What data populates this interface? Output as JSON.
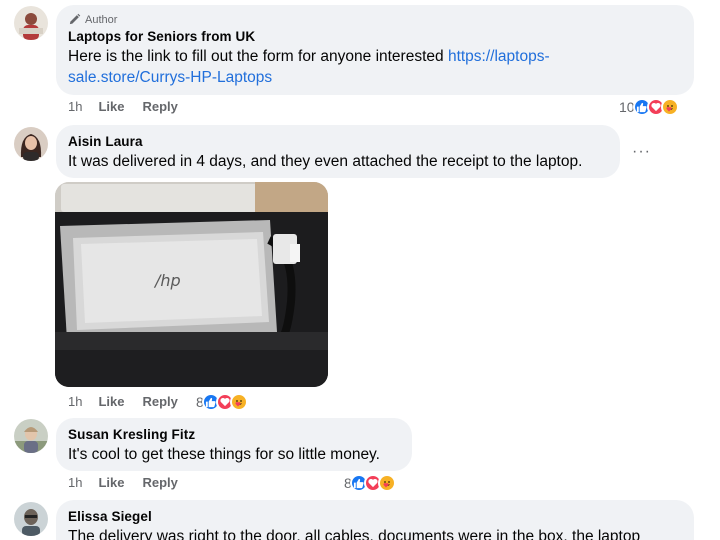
{
  "comments": [
    {
      "author_badge": "Author",
      "name": "Laptops for Seniors from UK",
      "text": "Here is the link to fill out the form for anyone interested ",
      "link_line1": "https://laptops-",
      "link_line2": "sale.store/Currys-HP-Laptops",
      "time": "1h",
      "like": "Like",
      "reply": "Reply",
      "reaction_count": "10"
    },
    {
      "name": "Aisin Laura",
      "text": "It was delivered in 4 days, and they even attached the receipt to the laptop.",
      "more": "···",
      "time": "1h",
      "like": "Like",
      "reply": "Reply",
      "reaction_count": "8"
    },
    {
      "name": "Susan Kresling Fitz",
      "text": "It's cool to get these things for so little money.",
      "time": "1h",
      "like": "Like",
      "reply": "Reply",
      "reaction_count": "8"
    },
    {
      "name": "Elissa Siegel",
      "text": "The delivery was right to the door, all cables, documents were in the box, the laptop"
    }
  ],
  "icons": {
    "author_badge": "pencil-icon",
    "reactions": [
      "like-icon",
      "love-icon",
      "care-icon"
    ]
  },
  "colors": {
    "link": "#216fdb",
    "bubble": "#f0f2f5",
    "secondary_text": "#65676b",
    "like": "#1877f2",
    "love": "#f33e58",
    "care": "#f7b125"
  }
}
